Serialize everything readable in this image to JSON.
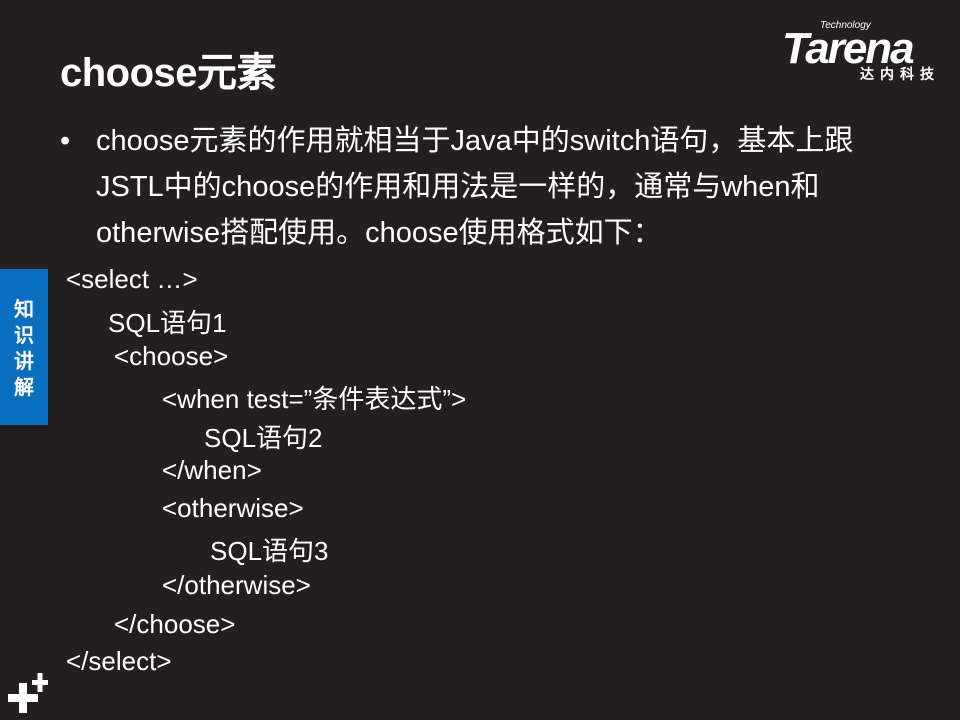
{
  "title": "choose元素",
  "logo": {
    "technology": "Technology",
    "name": "Tarena",
    "cn": "达内科技"
  },
  "side_tab": "知识讲解",
  "bullet": "choose元素的作用就相当于Java中的switch语句，基本上跟JSTL中的choose的作用和用法是一样的，通常与when和otherwise搭配使用。choose使用格式如下：",
  "code_lines": [
    "<select …>",
    "SQL语句1",
    "<choose>",
    "<when test=”条件表达式”>",
    "SQL语句2",
    "</when>",
    "<otherwise>",
    "SQL语句3",
    "</otherwise>",
    "</choose>",
    "</select>"
  ],
  "colors": {
    "background": "#231f20",
    "side_tab": "#0a6fbf"
  }
}
